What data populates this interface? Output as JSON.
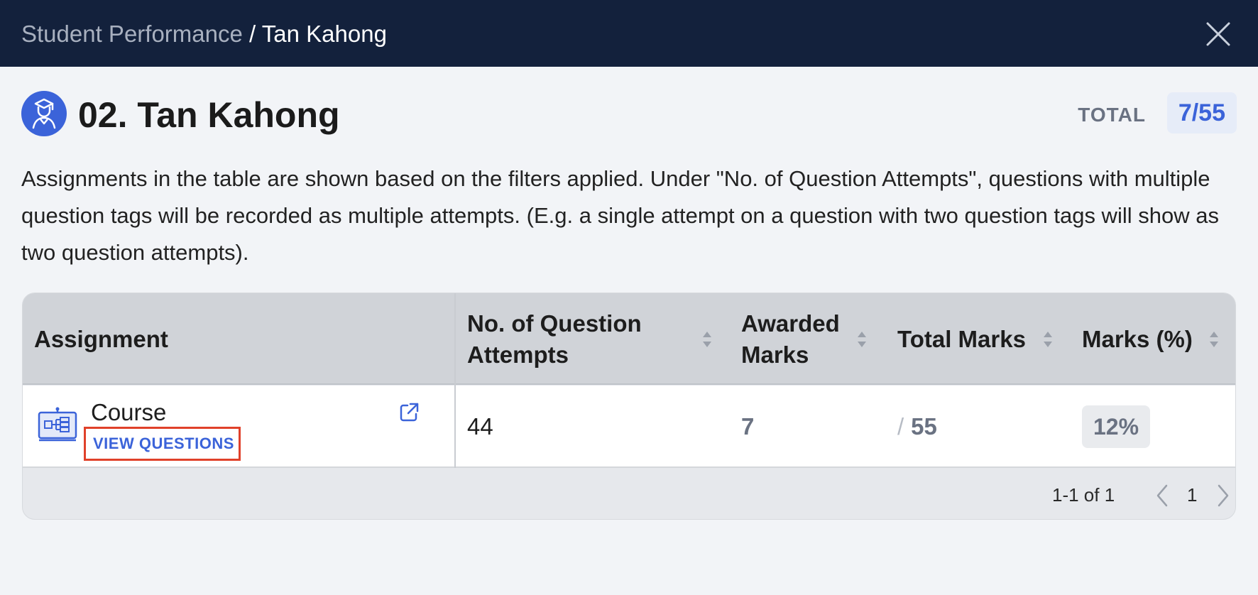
{
  "breadcrumb": {
    "parent": "Student Performance",
    "separator": " / ",
    "current": "Tan Kahong"
  },
  "icons": {
    "close": "close-icon",
    "avatar": "student-avatar-icon",
    "course": "course-board-icon",
    "external_link": "external-link-icon",
    "sort": "sort-icon",
    "prev": "chevron-left-icon",
    "next": "chevron-right-icon"
  },
  "header": {
    "student_name": "02. Tan Kahong",
    "total_label": "TOTAL",
    "total_value": "7/55"
  },
  "description": "Assignments in the table are shown based on the filters applied. Under \"No. of Question Attempts\", questions with multiple question tags will be recorded as multiple attempts. (E.g. a single attempt on a question with two question tags will show as two question attempts).",
  "table": {
    "columns": {
      "assignment": "Assignment",
      "attempts": "No. of Question Attempts",
      "awarded": "Awarded Marks",
      "total": "Total Marks",
      "percent": "Marks (%)"
    },
    "rows": [
      {
        "assignment": "Course",
        "view_questions": "VIEW QUESTIONS",
        "attempts": "44",
        "awarded": "7",
        "total_slash": "/",
        "total": "55",
        "percent": "12%"
      }
    ]
  },
  "pagination": {
    "range": "1-1 of 1",
    "page": "1"
  },
  "colors": {
    "topbar": "#13213c",
    "accent": "#3b63d9",
    "highlight_border": "#e0412a"
  }
}
